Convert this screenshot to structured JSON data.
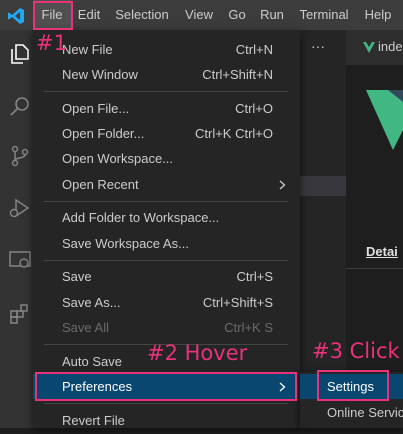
{
  "app_title": "Visual Studio Code",
  "menubar": {
    "items": [
      "File",
      "Edit",
      "Selection",
      "View",
      "Go",
      "Run",
      "Terminal",
      "Help"
    ],
    "active": "File"
  },
  "sidebar_more": "···",
  "editor": {
    "tab_label": "inde",
    "details_link": "Detai"
  },
  "file_menu": {
    "items": [
      {
        "label": "New File",
        "shortcut": "Ctrl+N"
      },
      {
        "label": "New Window",
        "shortcut": "Ctrl+Shift+N"
      },
      {
        "label": "Open File...",
        "shortcut": "Ctrl+O"
      },
      {
        "label": "Open Folder...",
        "shortcut": "Ctrl+K Ctrl+O"
      },
      {
        "label": "Open Workspace...",
        "shortcut": ""
      },
      {
        "label": "Open Recent",
        "shortcut": "",
        "submenu": true
      },
      {
        "label": "Add Folder to Workspace...",
        "shortcut": ""
      },
      {
        "label": "Save Workspace As...",
        "shortcut": ""
      },
      {
        "label": "Save",
        "shortcut": "Ctrl+S"
      },
      {
        "label": "Save As...",
        "shortcut": "Ctrl+Shift+S"
      },
      {
        "label": "Save All",
        "shortcut": "Ctrl+K S",
        "disabled": true
      },
      {
        "label": "Auto Save",
        "shortcut": ""
      },
      {
        "label": "Preferences",
        "shortcut": "",
        "submenu": true,
        "highlighted": true
      },
      {
        "label": "Revert File",
        "shortcut": ""
      }
    ]
  },
  "preferences_submenu": {
    "items": [
      "Settings",
      "Online Services Settings"
    ]
  },
  "annotations": {
    "step1": "#1",
    "step2": "#2 Hover",
    "step3": "#3 Click"
  },
  "colors": {
    "accent_highlight": "#094771",
    "annotation": "#e8327c",
    "vscode_blue": "#23a9f2",
    "vue_green": "#41b883"
  }
}
